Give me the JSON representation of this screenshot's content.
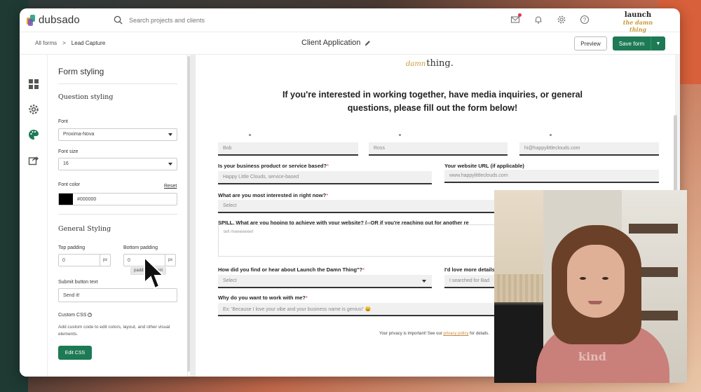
{
  "app": {
    "logo_text": "dubsado",
    "search_placeholder": "Search projects and clients",
    "brand_logo": "launch",
    "brand_logo_script": "the damn thing"
  },
  "breadcrumb": {
    "parent": "All forms",
    "separator": ">",
    "current": "Lead Capture"
  },
  "doc_title": "Client Application",
  "buttons": {
    "preview": "Preview",
    "save": "Save form"
  },
  "panel": {
    "title": "Form styling",
    "question_styling": "Question styling",
    "font_label": "Font",
    "font_value": "Proxima-Nova",
    "font_size_label": "Font size",
    "font_size_value": "16",
    "font_color_label": "Font color",
    "reset": "Reset",
    "font_color_value": "#000000",
    "general_styling": "General Styling",
    "top_padding_label": "Top padding",
    "top_padding_value": "0",
    "bottom_padding_label": "Bottom padding",
    "bottom_padding_value": "0",
    "unit": "px",
    "tooltip": "padding bottom",
    "submit_label": "Submit button text",
    "submit_value": "Send it!",
    "custom_css_label": "Custom CSS",
    "custom_css_help": "Add custom code to edit colors, layout, and other visual elements.",
    "edit_css": "Edit CSS"
  },
  "form": {
    "logo_script": "damn",
    "logo_text": "thing.",
    "heading": "If you're interested in working together, have media inquiries, or general questions, please fill out the form below!",
    "first_name": "Bob",
    "last_name": "Ross",
    "email": "hi@happylittleclouds.com",
    "business_q": "Is your business product or service based?",
    "business_a": "Happy Little Clouds, service-based",
    "website_q": "Your website URL (if applicable)",
    "website_a": "www.happylittleclouds.com",
    "interest_q": "What are you most interested in right now?",
    "select": "Select",
    "spill_q": "SPILL. What are you hoping to achieve with your website? (--OR if you're reaching out for another re",
    "spill_a": "tell meeeeeee!",
    "found_q": "How did you find or hear about Launch the Damn Thing\"?",
    "details_q": "I'd love more details",
    "details_a": "I searched for Bad",
    "why_q": "Why do you want to work with me?",
    "why_a": "Ex: 'Because I love your vibe and your business name is genius!' 😄",
    "required_mark": "*",
    "privacy_pre": "Your privacy is important! See our ",
    "privacy_link": "privacy policy",
    "privacy_post": " for details."
  },
  "cam": {
    "shirt_text": "kind"
  },
  "colors": {
    "accent": "#1d7a55",
    "required": "#dd3333"
  }
}
